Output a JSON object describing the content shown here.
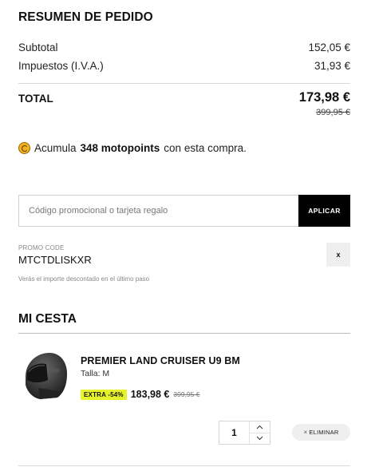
{
  "summary": {
    "title": "RESUMEN DE PEDIDO",
    "subtotal_label": "Subtotal",
    "subtotal_value": "152,05 €",
    "tax_label": "Impuestos (I.V.A.)",
    "tax_value": "31,93 €",
    "total_label": "TOTAL",
    "total_value": "173,98 €",
    "total_old": "399,95 €"
  },
  "points": {
    "prefix": "Acumula",
    "amount": "348 motopoints",
    "suffix": "con esta compra.",
    "icon": "motopoints-coin-icon",
    "coin_color": "#f2b21f"
  },
  "promo": {
    "placeholder": "Código promocional o tarjeta regalo",
    "apply_label": "APLICAR",
    "code_label": "PROMO CODE",
    "code_value": "MTCTDLISKXR",
    "remove_label": "x",
    "note": "Verás el importe descontado en el último paso"
  },
  "cart": {
    "title": "MI CESTA",
    "items": [
      {
        "name": "PREMIER LAND CRUISER U9 BM",
        "size": "Talla: M",
        "badge": "EXTRA -54%",
        "price": "183,98 €",
        "old_price": "399,95 €",
        "quantity": "1",
        "remove_label": "ELIMINAR",
        "image_icon": "helmet-image"
      }
    ],
    "badge_color": "#e6f22a"
  }
}
